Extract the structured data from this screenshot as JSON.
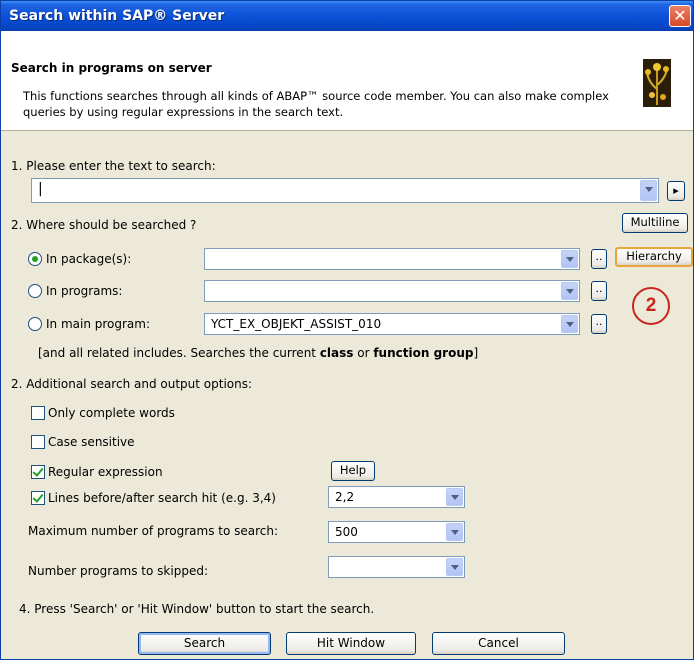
{
  "window": {
    "title": "Search within SAP® Server",
    "close_glyph": "✕"
  },
  "header": {
    "title": "Search in programs on server",
    "description": "This functions searches through all kinds of ABAP™ source code member. You can also make complex queries by using regular expressions in the search text."
  },
  "step1": {
    "label": "1. Please enter the text to search:",
    "search_text": "",
    "next_glyph": "▸"
  },
  "step2": {
    "label": "2. Where should be searched ?",
    "multiline_button": "Multiline",
    "hierarchy_button": "Hierarchy",
    "dots_label": "..",
    "options": [
      {
        "label": "In package(s):",
        "value": "",
        "selected": true
      },
      {
        "label": "In programs:",
        "value": "",
        "selected": false
      },
      {
        "label": "In main program:",
        "value": "YCT_EX_OBJEKT_ASSIST_010",
        "selected": false
      }
    ],
    "note_prefix": "[and all related includes. Searches the current ",
    "note_class": "class",
    "note_or": " or ",
    "note_function_group": "function group",
    "note_suffix": "]"
  },
  "step3": {
    "label": "2. Additional search and output options:",
    "only_complete_words": {
      "label": "Only complete words",
      "checked": false
    },
    "case_sensitive": {
      "label": "Case sensitive",
      "checked": false
    },
    "regular_expression": {
      "label": "Regular expression",
      "checked": true
    },
    "help_button": "Help",
    "lines_before_after": {
      "label": "Lines before/after search hit (e.g. 3,4)",
      "checked": true,
      "value": "2,2"
    },
    "max_programs": {
      "label": "Maximum number of programs to search:",
      "value": "500"
    },
    "programs_skipped": {
      "label": "Number programs to skipped:",
      "value": ""
    }
  },
  "step4": {
    "label": "4. Press 'Search' or 'Hit Window' button to start the search."
  },
  "buttons": {
    "search": "Search",
    "hit_window": "Hit Window",
    "cancel": "Cancel"
  },
  "annotation": {
    "number": "2",
    "color": "#c8261c"
  },
  "colors": {
    "titlebar": "#0a4fd6",
    "dialog_bg": "#ece9d8",
    "check_green": "#21a121"
  }
}
